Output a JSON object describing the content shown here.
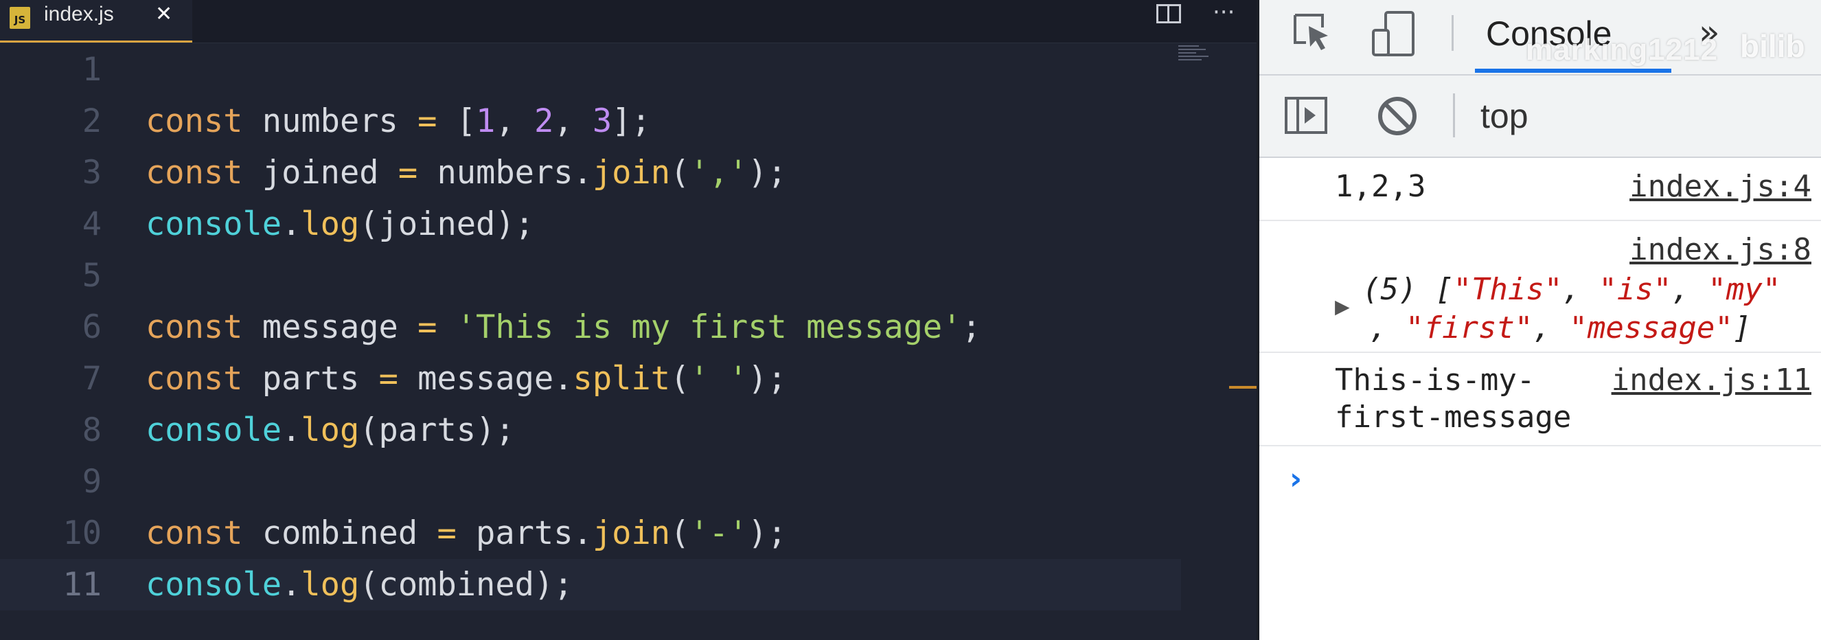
{
  "editor": {
    "tab": {
      "badge": "JS",
      "label": "index.js",
      "close": "✕"
    },
    "more": "···",
    "lines": [
      {
        "n": "1",
        "t": []
      },
      {
        "n": "2",
        "t": [
          [
            "kw",
            "const"
          ],
          [
            "p",
            " numbers "
          ],
          [
            "op",
            "="
          ],
          [
            "p",
            " ["
          ],
          [
            "num",
            "1"
          ],
          [
            "p",
            ", "
          ],
          [
            "num",
            "2"
          ],
          [
            "p",
            ", "
          ],
          [
            "num",
            "3"
          ],
          [
            "p",
            "];"
          ]
        ]
      },
      {
        "n": "3",
        "t": [
          [
            "kw",
            "const"
          ],
          [
            "p",
            " joined "
          ],
          [
            "op",
            "="
          ],
          [
            "p",
            " numbers."
          ],
          [
            "fn",
            "join"
          ],
          [
            "p",
            "("
          ],
          [
            "str",
            "','"
          ],
          [
            "p",
            ");"
          ]
        ]
      },
      {
        "n": "4",
        "t": [
          [
            "obj",
            "console"
          ],
          [
            "p",
            "."
          ],
          [
            "fn",
            "log"
          ],
          [
            "p",
            "(joined);"
          ]
        ]
      },
      {
        "n": "5",
        "t": []
      },
      {
        "n": "6",
        "t": [
          [
            "kw",
            "const"
          ],
          [
            "p",
            " message "
          ],
          [
            "op",
            "="
          ],
          [
            "p",
            " "
          ],
          [
            "str",
            "'This is my first message'"
          ],
          [
            "p",
            ";"
          ]
        ]
      },
      {
        "n": "7",
        "t": [
          [
            "kw",
            "const"
          ],
          [
            "p",
            " parts "
          ],
          [
            "op",
            "="
          ],
          [
            "p",
            " message."
          ],
          [
            "fn",
            "split"
          ],
          [
            "p",
            "("
          ],
          [
            "str",
            "' '"
          ],
          [
            "p",
            ");"
          ]
        ]
      },
      {
        "n": "8",
        "t": [
          [
            "obj",
            "console"
          ],
          [
            "p",
            "."
          ],
          [
            "fn",
            "log"
          ],
          [
            "p",
            "(parts);"
          ]
        ]
      },
      {
        "n": "9",
        "t": []
      },
      {
        "n": "10",
        "t": [
          [
            "kw",
            "const"
          ],
          [
            "p",
            " combined "
          ],
          [
            "op",
            "="
          ],
          [
            "p",
            " parts."
          ],
          [
            "fn",
            "join"
          ],
          [
            "p",
            "("
          ],
          [
            "str",
            "'-'"
          ],
          [
            "p",
            ");"
          ]
        ]
      },
      {
        "n": "11",
        "t": [
          [
            "obj",
            "console"
          ],
          [
            "p",
            "."
          ],
          [
            "fn",
            "log"
          ],
          [
            "p",
            "(combined);"
          ]
        ]
      }
    ]
  },
  "devtools": {
    "tab_console": "Console",
    "more_tabs": "»",
    "context": "top",
    "watermark": "marking1212",
    "watermark_logo": "bilib",
    "messages": {
      "m1": {
        "text": "1,2,3",
        "src": "index.js:4"
      },
      "m2": {
        "src": "index.js:8",
        "arrow": "▶",
        "count": "(5) [",
        "items": [
          "\"This\"",
          "\"is\"",
          "\"my\"",
          "\"first\"",
          "\"message\""
        ],
        "close": "]"
      },
      "m3": {
        "line1": "This-is-my-",
        "line2": "first-message",
        "src": "index.js:11"
      }
    },
    "prompt": "›"
  },
  "colors": {
    "keyword": "#e5a45a",
    "string": "#a4d06a",
    "number": "#bf8cf2",
    "object": "#4fd1d9",
    "accent": "#1a73e8"
  }
}
